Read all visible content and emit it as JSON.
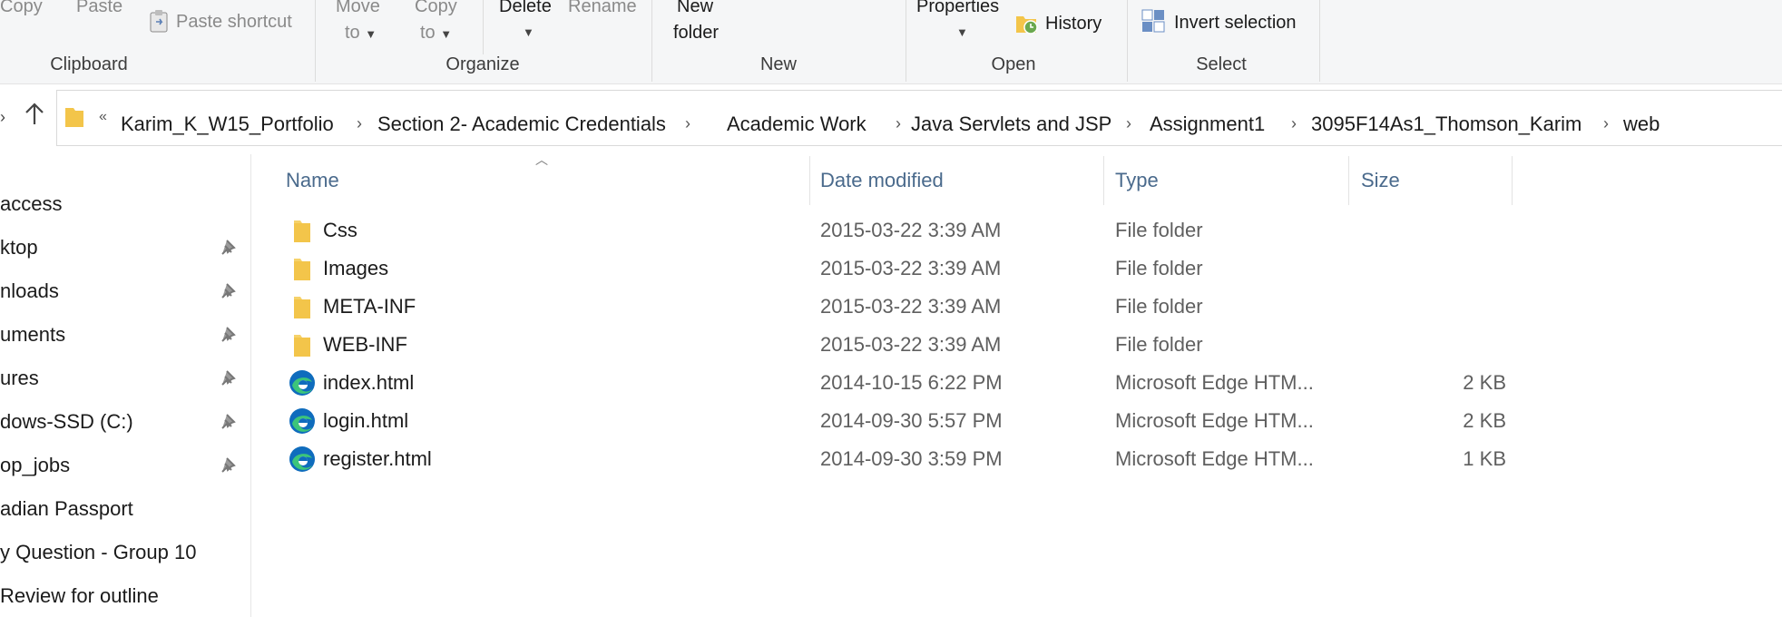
{
  "ribbon": {
    "clipboard": {
      "copy": "Copy",
      "paste": "Paste",
      "paste_shortcut": "Paste shortcut",
      "label": "Clipboard"
    },
    "organize": {
      "move_to_1": "Move",
      "move_to_2": "to",
      "copy_to_1": "Copy",
      "copy_to_2": "to",
      "delete": "Delete",
      "rename": "Rename",
      "label": "Organize"
    },
    "new": {
      "new_folder_1": "New",
      "new_folder_2": "folder",
      "label": "New"
    },
    "open": {
      "properties": "Properties",
      "history": "History",
      "label": "Open"
    },
    "select": {
      "invert_selection": "Invert selection",
      "label": "Select"
    }
  },
  "breadcrumb": {
    "overflow": "«",
    "items": [
      "Karim_K_W15_Portfolio",
      "Section 2- Academic Credentials",
      "Academic Work",
      "Java Servlets and JSP",
      "Assignment1",
      "3095F14As1_Thomson_Karim",
      "web"
    ]
  },
  "nav": {
    "items": [
      {
        "label": "access",
        "pinned": false
      },
      {
        "label": "ktop",
        "pinned": true
      },
      {
        "label": "nloads",
        "pinned": true
      },
      {
        "label": "uments",
        "pinned": true
      },
      {
        "label": "ures",
        "pinned": true
      },
      {
        "label": "dows-SSD (C:)",
        "pinned": true
      },
      {
        "label": "op_jobs",
        "pinned": true
      },
      {
        "label": "adian Passport",
        "pinned": false
      },
      {
        "label": "y Question - Group 10",
        "pinned": false
      },
      {
        "label": "Review for outline",
        "pinned": false
      }
    ]
  },
  "columns": {
    "name": "Name",
    "date": "Date modified",
    "type": "Type",
    "size": "Size"
  },
  "files": [
    {
      "name": "Css",
      "date": "2015-03-22 3:39 AM",
      "type": "File folder",
      "size": "",
      "icon": "folder-icon"
    },
    {
      "name": "Images",
      "date": "2015-03-22 3:39 AM",
      "type": "File folder",
      "size": "",
      "icon": "folder-icon"
    },
    {
      "name": "META-INF",
      "date": "2015-03-22 3:39 AM",
      "type": "File folder",
      "size": "",
      "icon": "folder-icon"
    },
    {
      "name": "WEB-INF",
      "date": "2015-03-22 3:39 AM",
      "type": "File folder",
      "size": "",
      "icon": "folder-icon"
    },
    {
      "name": "index.html",
      "date": "2014-10-15 6:22 PM",
      "type": "Microsoft Edge HTM...",
      "size": "2 KB",
      "icon": "edge-icon"
    },
    {
      "name": "login.html",
      "date": "2014-09-30 5:57 PM",
      "type": "Microsoft Edge HTM...",
      "size": "2 KB",
      "icon": "edge-icon"
    },
    {
      "name": "register.html",
      "date": "2014-09-30 3:59 PM",
      "type": "Microsoft Edge HTM...",
      "size": "1 KB",
      "icon": "edge-icon"
    }
  ],
  "colors": {
    "folder": "#f3c54a",
    "edge_blue": "#0f6cbd",
    "edge_green": "#3cc57a",
    "header_text": "#4a6a8c"
  }
}
